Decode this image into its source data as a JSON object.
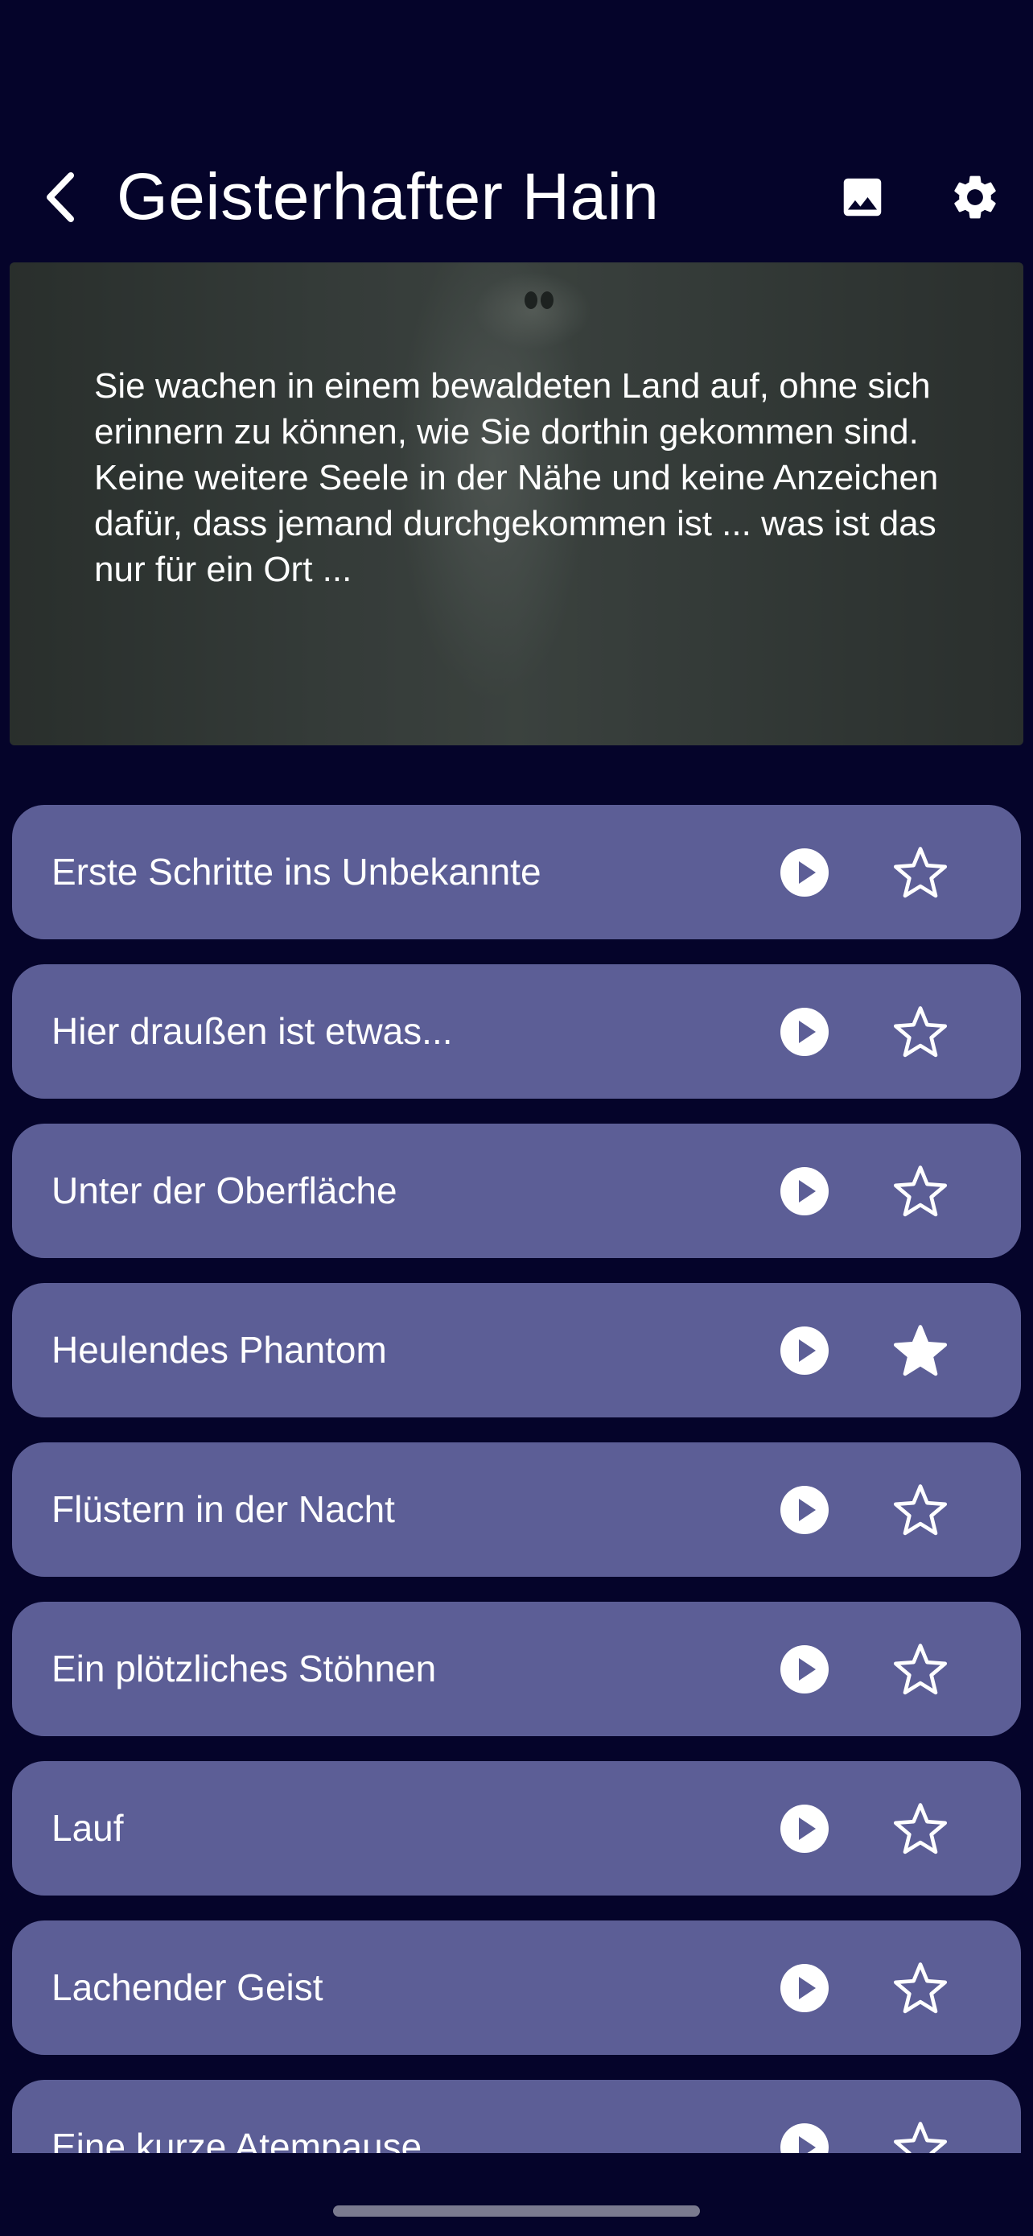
{
  "header": {
    "title": "Geisterhafter Hain",
    "back_icon": "chevron-left-icon",
    "image_icon": "image-icon",
    "settings_icon": "gear-icon"
  },
  "hero": {
    "description": "Sie wachen in einem bewaldeten Land auf, ohne sich erinnern zu können, wie Sie dorthin gekommen sind. Keine weitere Seele in der Nähe und keine Anzeichen dafür, dass jemand durchgekommen ist ... was ist das nur für ein Ort ..."
  },
  "colors": {
    "background": "#05042a",
    "item_background": "#5c5e96",
    "icon": "#ffffff"
  },
  "tracks": [
    {
      "title": "Erste Schritte ins Unbekannte",
      "favorite": false
    },
    {
      "title": "Hier draußen ist etwas...",
      "favorite": false
    },
    {
      "title": "Unter der Oberfläche",
      "favorite": false
    },
    {
      "title": "Heulendes Phantom",
      "favorite": true
    },
    {
      "title": "Flüstern in der Nacht",
      "favorite": false
    },
    {
      "title": "Ein plötzliches Stöhnen",
      "favorite": false
    },
    {
      "title": "Lauf",
      "favorite": false
    },
    {
      "title": "Lachender Geist",
      "favorite": false
    },
    {
      "title": "Eine kurze Atempause",
      "favorite": false
    }
  ]
}
